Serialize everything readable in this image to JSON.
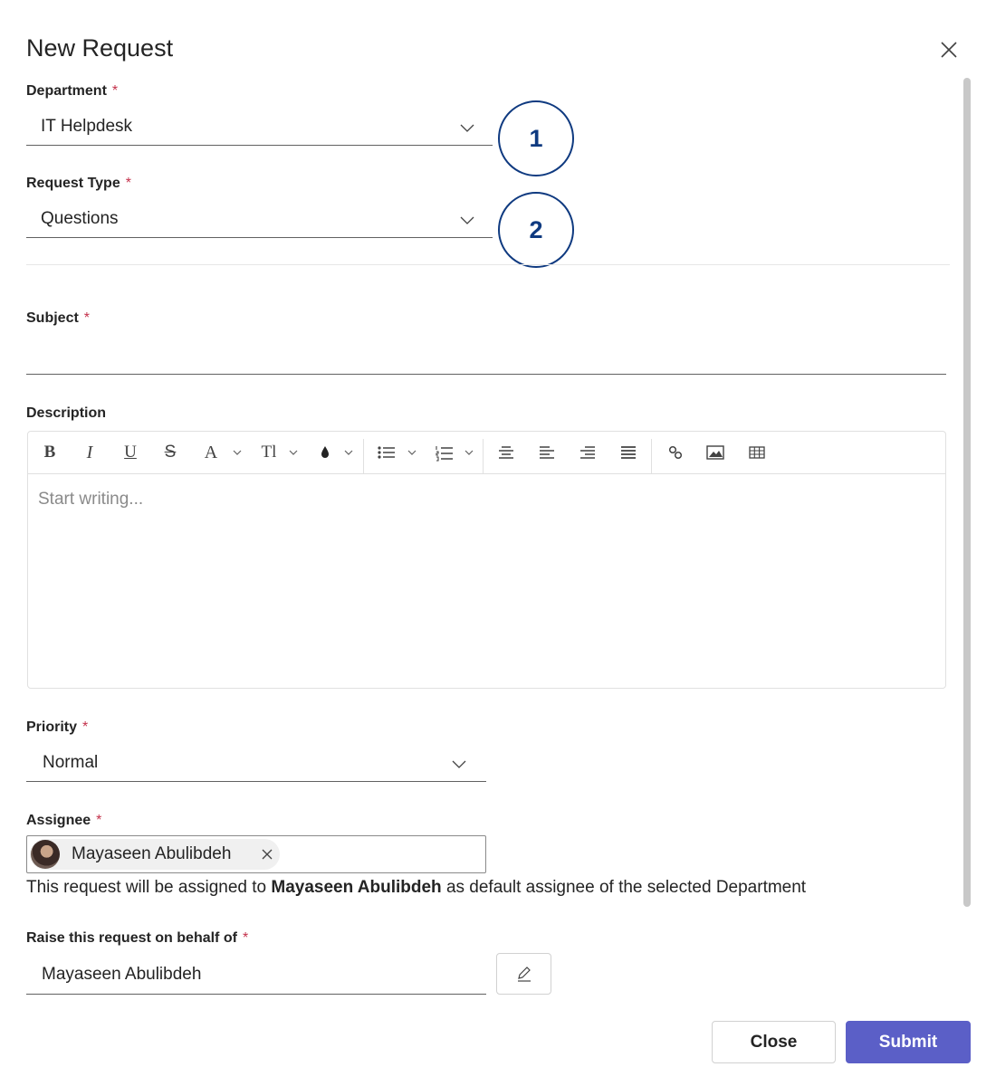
{
  "dialog": {
    "title": "New Request"
  },
  "department": {
    "label": "Department",
    "required_mark": "*",
    "value": "IT Helpdesk",
    "badge": "1"
  },
  "request_type": {
    "label": "Request Type",
    "required_mark": "*",
    "value": "Questions",
    "badge": "2"
  },
  "subject": {
    "label": "Subject",
    "required_mark": "*",
    "value": ""
  },
  "description": {
    "label": "Description",
    "placeholder": "Start writing...",
    "toolbar_icons": [
      "bold-icon",
      "italic-icon",
      "underline-icon",
      "strikethrough-icon",
      "font-color-icon",
      "font-size-icon",
      "highlight-icon",
      "bulleted-list-icon",
      "numbered-list-icon",
      "align-center-icon",
      "align-left-icon",
      "align-right-icon",
      "align-justify-icon",
      "link-icon",
      "image-icon",
      "table-icon"
    ]
  },
  "priority": {
    "label": "Priority",
    "required_mark": "*",
    "value": "Normal"
  },
  "assignee": {
    "label": "Assignee",
    "required_mark": "*",
    "chip_name": "Mayaseen Abulibdeh",
    "note_prefix": "This request will be assigned to ",
    "note_name": "Mayaseen Abulibdeh",
    "note_suffix": " as default assignee of the selected Department"
  },
  "behalf": {
    "label": "Raise this request on behalf of",
    "required_mark": "*",
    "value": "Mayaseen Abulibdeh"
  },
  "footer": {
    "close_label": "Close",
    "submit_label": "Submit"
  },
  "colors": {
    "accent": "#5b5fc7",
    "required": "#c4314b",
    "badge": "#0f3a80"
  }
}
